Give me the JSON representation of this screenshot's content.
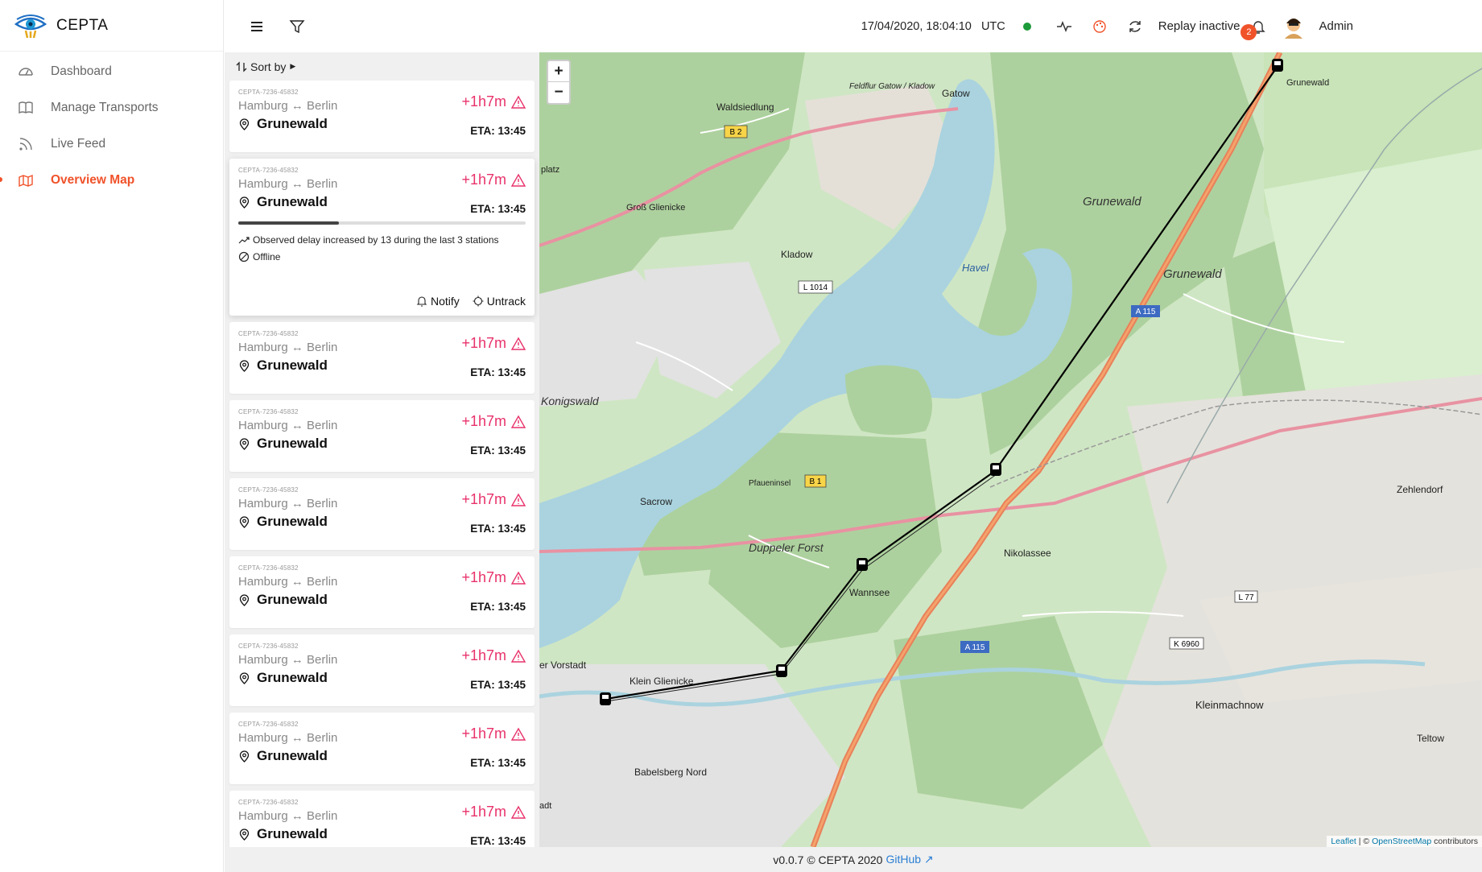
{
  "app": {
    "brand": "CEPTA"
  },
  "sidebar": {
    "items": [
      {
        "label": "Dashboard",
        "icon": "dashboard-icon",
        "active": false
      },
      {
        "label": "Manage Transports",
        "icon": "book-icon",
        "active": false
      },
      {
        "label": "Live Feed",
        "icon": "rss-icon",
        "active": false
      },
      {
        "label": "Overview Map",
        "icon": "map-icon",
        "active": true
      }
    ]
  },
  "header": {
    "datetime": "17/04/2020, 18:04:10",
    "timezone": "UTC",
    "replay_label": "Replay inactive",
    "notification_count": "2",
    "user_name": "Admin",
    "status_color": "#1d9a3a"
  },
  "list": {
    "sort_label": "Sort by",
    "transports": [
      {
        "id": "CEPTA-7236-45832",
        "origin": "Hamburg",
        "destination": "Berlin",
        "station": "Grunewald",
        "delay": "+1h7m",
        "eta": "ETA: 13:45"
      },
      {
        "id": "CEPTA-7236-45832",
        "origin": "Hamburg",
        "destination": "Berlin",
        "station": "Grunewald",
        "delay": "+1h7m",
        "eta": "ETA: 13:45",
        "expanded": true,
        "progress": 0.35,
        "observation": "Observed delay increased by 13 during the last 3 stations",
        "status": "Offline",
        "notify_label": "Notify",
        "untrack_label": "Untrack"
      },
      {
        "id": "CEPTA-7236-45832",
        "origin": "Hamburg",
        "destination": "Berlin",
        "station": "Grunewald",
        "delay": "+1h7m",
        "eta": "ETA: 13:45"
      },
      {
        "id": "CEPTA-7236-45832",
        "origin": "Hamburg",
        "destination": "Berlin",
        "station": "Grunewald",
        "delay": "+1h7m",
        "eta": "ETA: 13:45"
      },
      {
        "id": "CEPTA-7236-45832",
        "origin": "Hamburg",
        "destination": "Berlin",
        "station": "Grunewald",
        "delay": "+1h7m",
        "eta": "ETA: 13:45"
      },
      {
        "id": "CEPTA-7236-45832",
        "origin": "Hamburg",
        "destination": "Berlin",
        "station": "Grunewald",
        "delay": "+1h7m",
        "eta": "ETA: 13:45"
      },
      {
        "id": "CEPTA-7236-45832",
        "origin": "Hamburg",
        "destination": "Berlin",
        "station": "Grunewald",
        "delay": "+1h7m",
        "eta": "ETA: 13:45"
      },
      {
        "id": "CEPTA-7236-45832",
        "origin": "Hamburg",
        "destination": "Berlin",
        "station": "Grunewald",
        "delay": "+1h7m",
        "eta": "ETA: 13:45"
      },
      {
        "id": "CEPTA-7236-45832",
        "origin": "Hamburg",
        "destination": "Berlin",
        "station": "Grunewald",
        "delay": "+1h7m",
        "eta": "ETA: 13:45"
      }
    ],
    "delay_color": "#e8326b"
  },
  "map": {
    "zoom_in": "+",
    "zoom_out": "−",
    "labels": {
      "gatow": "Gatow",
      "waldsiedlung": "Waldsiedlung",
      "kladow": "Kladow",
      "grunewald_forest": "Grunewald",
      "grunewald_forest2": "Grunewald",
      "grunewald_town": "Grunewald",
      "havel": "Havel",
      "sacrow": "Sacrow",
      "duppeler_forst": "Duppeler Forst",
      "wannsee": "Wannsee",
      "nikolassee": "Nikolassee",
      "zehlendorf": "Zehlendorf",
      "kleinmachnow": "Kleinmachnow",
      "teltow": "Teltow",
      "babelsberg_nord": "Babelsberg Nord",
      "klein_glienicke": "Klein Glienicke",
      "gross_glienicke": "Groß Glienicke",
      "konigswald": "Konigswald",
      "pfaueninsel": "Pfaueninsel",
      "feldflur": "Feldflur Gatow / Kladow",
      "b2": "B 2",
      "b1": "B 1",
      "a115": "A 115",
      "a115b": "A 115",
      "l1014": "L 1014",
      "l77": "L 77",
      "k6960": "K 6960",
      "vorstadt": "er Vorstadt",
      "platz": "platz",
      "adt": "adt"
    },
    "attribution_leaflet": "Leaflet",
    "attribution_sep": " | © ",
    "attribution_osm": "OpenStreetMap",
    "attribution_tail": " contributors"
  },
  "footer": {
    "text": "v0.0.7 © CEPTA 2020",
    "link": "GitHub"
  }
}
